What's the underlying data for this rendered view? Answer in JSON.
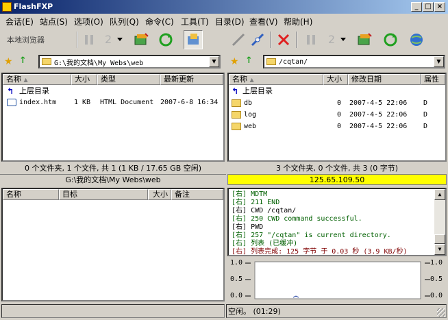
{
  "window": {
    "title": "FlashFXP"
  },
  "menu": [
    "会话(E)",
    "站点(S)",
    "选项(O)",
    "队列(Q)",
    "命令(C)",
    "工具(T)",
    "目录(D)",
    "查看(V)",
    "帮助(H)"
  ],
  "toolbar": {
    "local_browser_label": "本地浏览器"
  },
  "local": {
    "path": "G:\\我的文档\\My Webs\\web",
    "columns": [
      "名称",
      "大小",
      "类型",
      "最新更新"
    ],
    "up_label": "上层目录",
    "files": [
      {
        "name": "index.htm",
        "size": "1 KB",
        "type": "HTML Document",
        "modified": "2007-6-8 16:34"
      }
    ],
    "status": "0 个文件夹, 1 个文件, 共 1 (1 KB / 17.65 GB 空闲)",
    "status_path": "G:\\我的文档\\My Webs\\web"
  },
  "remote": {
    "path": "/cqtan/",
    "columns": [
      "名称",
      "大小",
      "修改日期",
      "属性"
    ],
    "up_label": "上层目录",
    "files": [
      {
        "name": "db",
        "size": "0",
        "modified": "2007-4-5 22:06",
        "attr": "D"
      },
      {
        "name": "log",
        "size": "0",
        "modified": "2007-4-5 22:06",
        "attr": "D"
      },
      {
        "name": "web",
        "size": "0",
        "modified": "2007-4-5 22:06",
        "attr": "D"
      }
    ],
    "status": "3 个文件夹, 0 个文件, 共 3 (0 字节)",
    "server_ip": "125.65.109.50"
  },
  "queue": {
    "columns": [
      "名称",
      "目标",
      "大小",
      "备注"
    ]
  },
  "log": [
    {
      "prefix": "[右]",
      "text": "   MDTM",
      "color": "#006000"
    },
    {
      "prefix": "[右]",
      "text": "211 END",
      "color": "#006000"
    },
    {
      "prefix": "[右]",
      "text": "CWD /cqtan/",
      "color": "#000000"
    },
    {
      "prefix": "[右]",
      "text": "250 CWD command successful.",
      "color": "#006000"
    },
    {
      "prefix": "[右]",
      "text": "PWD",
      "color": "#000000"
    },
    {
      "prefix": "[右]",
      "text": "257 \"/cqtan\" is current directory.",
      "color": "#006000"
    },
    {
      "prefix": "[右]",
      "text": "列表 (已缓冲)",
      "color": "#006000"
    },
    {
      "prefix": "[右]",
      "text": "列表完成: 125 字节 于 0.03 秒 (3.9 KB/秒)",
      "color": "#800000"
    }
  ],
  "graph": {
    "left_ticks": [
      "1.0",
      "0.5",
      "0.0"
    ],
    "right_ticks": [
      "1.0",
      "0.5",
      "0.0"
    ]
  },
  "bottom_status": "空闲。 (01:29)",
  "colors": {
    "ip_bar": "#ffff00",
    "title_start": "#0a246a",
    "title_end": "#a6caf0"
  }
}
